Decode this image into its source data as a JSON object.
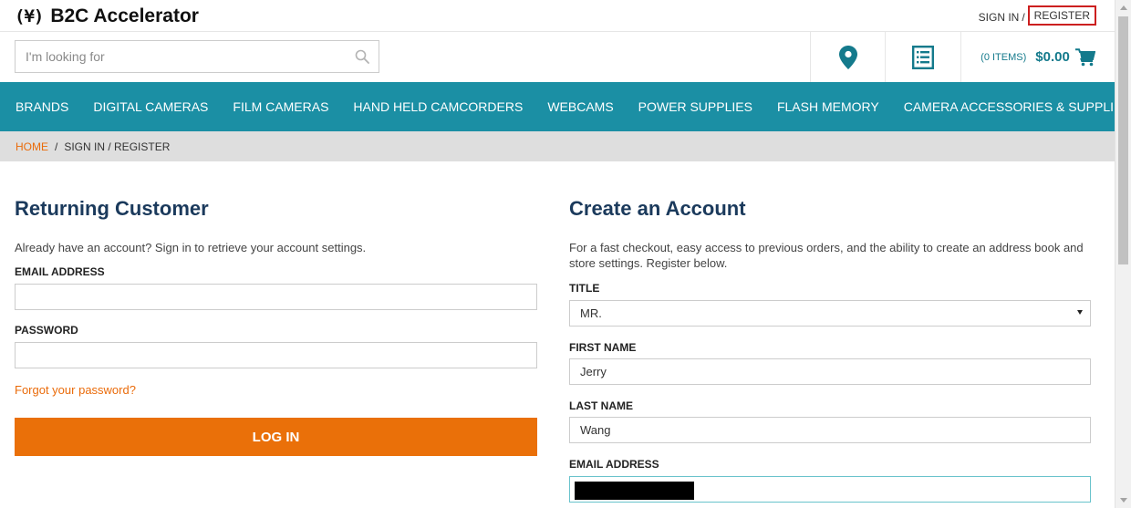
{
  "header": {
    "logo_mark": "(¥)",
    "logo_text": "B2C Accelerator",
    "sign_in_label": "SIGN IN",
    "separator": "/",
    "register_label": "REGISTER"
  },
  "search": {
    "placeholder": "I'm looking for",
    "icon": "search-icon"
  },
  "utility": {
    "store_finder_icon": "map-pin-icon",
    "quick_order_icon": "list-icon",
    "cart_items_label": "(0 ITEMS)",
    "cart_total": "$0.00",
    "cart_icon": "cart-icon"
  },
  "nav": {
    "items": [
      {
        "label": "BRANDS"
      },
      {
        "label": "DIGITAL CAMERAS"
      },
      {
        "label": "FILM CAMERAS"
      },
      {
        "label": "HAND HELD CAMCORDERS"
      },
      {
        "label": "WEBCAMS"
      },
      {
        "label": "POWER SUPPLIES"
      },
      {
        "label": "FLASH MEMORY"
      },
      {
        "label": "CAMERA ACCESSORIES & SUPPLIES"
      }
    ]
  },
  "breadcrumb": {
    "home": "HOME",
    "separator": "/",
    "current": "SIGN IN / REGISTER"
  },
  "login": {
    "title": "Returning Customer",
    "intro": "Already have an account? Sign in to retrieve your account settings.",
    "email_label": "EMAIL ADDRESS",
    "email_value": "",
    "password_label": "PASSWORD",
    "password_value": "",
    "forgot_label": "Forgot your password?",
    "submit_label": "LOG IN"
  },
  "register": {
    "title": "Create an Account",
    "intro": "For a fast checkout, easy access to previous orders, and the ability to create an address book and store settings. Register below.",
    "title_label": "TITLE",
    "title_value": "MR.",
    "first_name_label": "FIRST NAME",
    "first_name_value": "Jerry",
    "last_name_label": "LAST NAME",
    "last_name_value": "Wang",
    "email_label": "EMAIL ADDRESS"
  },
  "colors": {
    "nav_bg": "#1b8fa4",
    "accent_orange": "#ea7009",
    "heading": "#1b3a5c",
    "highlight_red": "#cc1f1f"
  }
}
